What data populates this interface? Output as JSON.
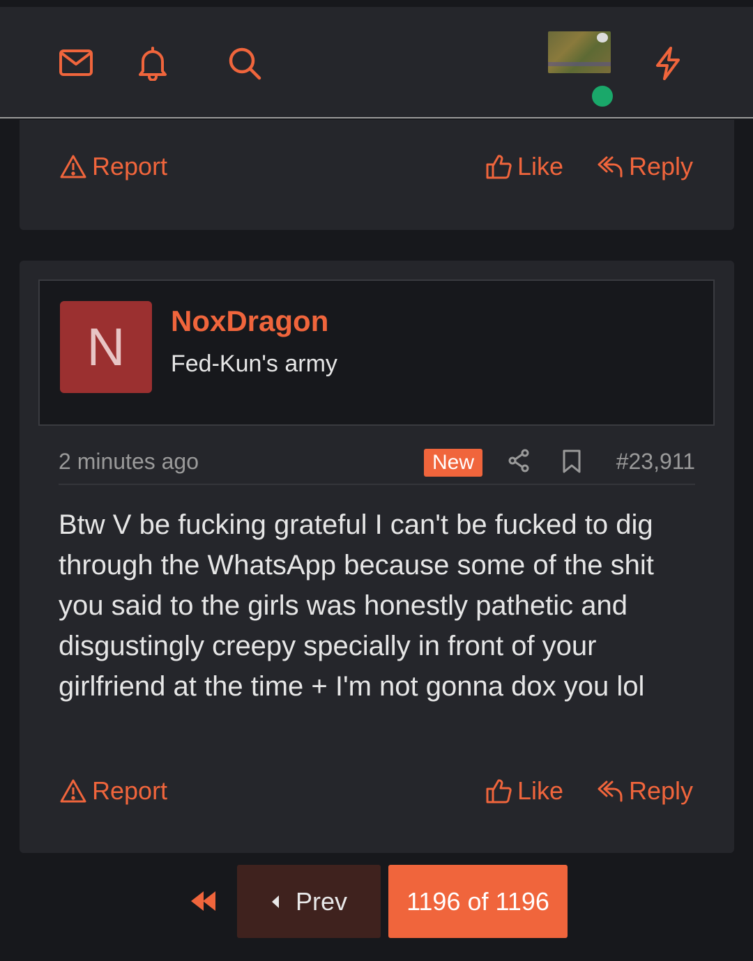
{
  "navbar": {
    "icons": [
      "mail-icon",
      "bell-icon",
      "search-icon",
      "lightning-icon"
    ],
    "accent_color": "#f0653c",
    "online_status_color": "#1aa86a"
  },
  "previous_post": {
    "report_label": "Report",
    "like_label": "Like",
    "reply_label": "Reply"
  },
  "post": {
    "avatar_letter": "N",
    "avatar_color": "#9b3030",
    "username": "NoxDragon",
    "user_title": "Fed-Kun's army",
    "timestamp": "2 minutes ago",
    "badge": "New",
    "post_number": "#23,911",
    "body": "Btw V be fucking grateful I can't be fucked to dig through the WhatsApp because some of the shit you said to the girls was honestly pathetic and disgustingly creepy specially in front of your girlfriend at the time + I'm not gonna dox you lol",
    "report_label": "Report",
    "like_label": "Like",
    "reply_label": "Reply"
  },
  "pagination": {
    "prev_label": "Prev",
    "current_label": "1196 of 1196"
  }
}
